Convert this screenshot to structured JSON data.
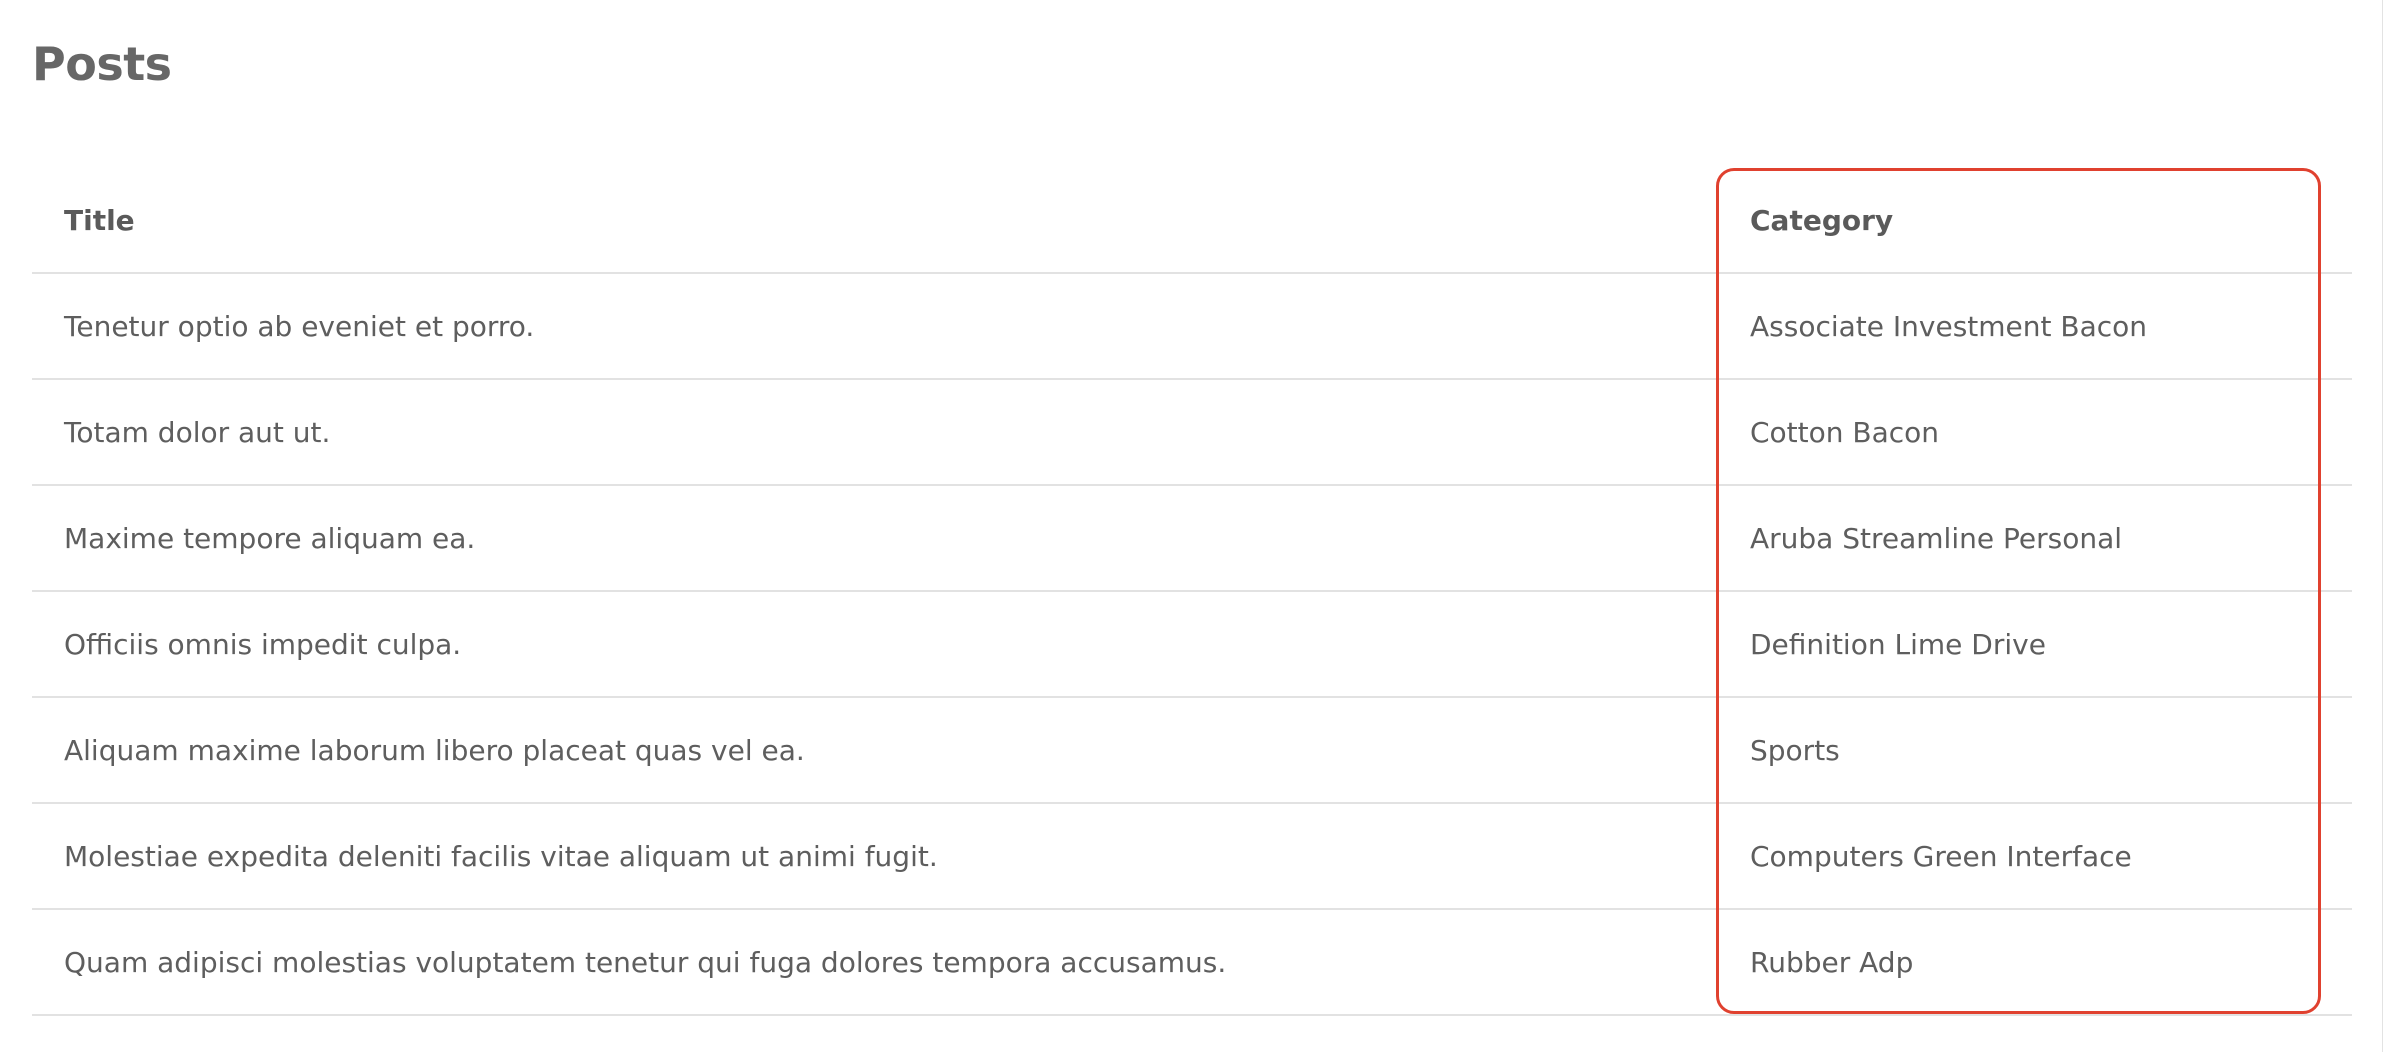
{
  "page": {
    "title": "Posts"
  },
  "table": {
    "columns": {
      "title": "Title",
      "category": "Category"
    },
    "rows": [
      {
        "title": "Tenetur optio ab eveniet et porro.",
        "category": "Associate Investment Bacon"
      },
      {
        "title": "Totam dolor aut ut.",
        "category": "Cotton Bacon"
      },
      {
        "title": "Maxime tempore aliquam ea.",
        "category": "Aruba Streamline Personal"
      },
      {
        "title": "Officiis omnis impedit culpa.",
        "category": "Definition Lime Drive"
      },
      {
        "title": "Aliquam maxime laborum libero placeat quas vel ea.",
        "category": "Sports"
      },
      {
        "title": "Molestiae expedita deleniti facilis vitae aliquam ut animi fugit.",
        "category": "Computers Green Interface"
      },
      {
        "title": "Quam adipisci molestias voluptatem tenetur qui fuga dolores tempora accusamus.",
        "category": "Rubber Adp"
      }
    ]
  },
  "colors": {
    "text": "#5e5e5e",
    "heading": "#676767",
    "divider": "#e2e2e2",
    "highlight": "#e0412f"
  }
}
